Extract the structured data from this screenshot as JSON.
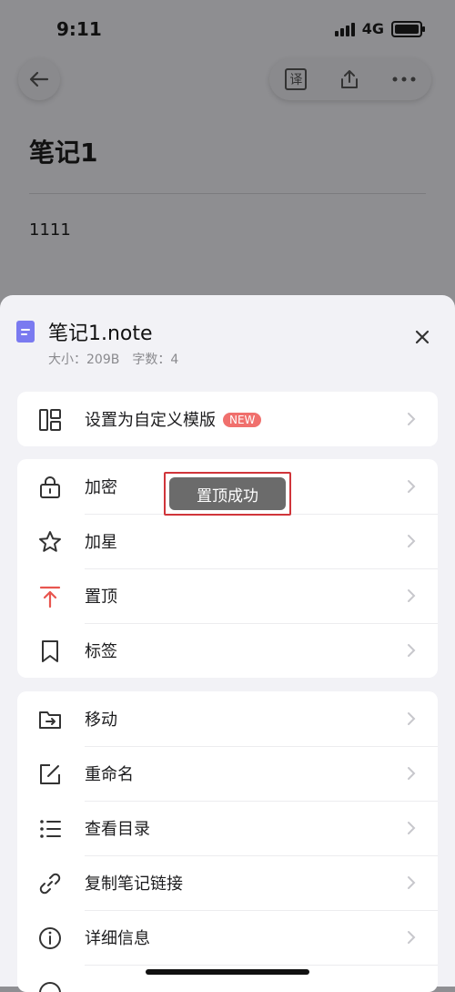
{
  "status_bar": {
    "time": "9:11",
    "network": "4G"
  },
  "note": {
    "title": "笔记1",
    "body": "1111"
  },
  "toolbar": {
    "icons": [
      "back-arrow-icon",
      "translate-icon",
      "share-icon",
      "more-icon"
    ],
    "translate_glyph": "译"
  },
  "sheet": {
    "file_name": "笔记1.note",
    "file_meta": "大小：209B　字数：4",
    "groups": [
      {
        "items": [
          {
            "label": "设置为自定义模版",
            "icon": "template-icon",
            "badge": "NEW"
          }
        ]
      },
      {
        "items": [
          {
            "label": "加密",
            "icon": "lock-icon"
          },
          {
            "label": "加星",
            "icon": "star-icon"
          },
          {
            "label": "置顶",
            "icon": "pin-top-icon"
          },
          {
            "label": "标签",
            "icon": "bookmark-icon"
          }
        ]
      },
      {
        "items": [
          {
            "label": "移动",
            "icon": "move-folder-icon"
          },
          {
            "label": "重命名",
            "icon": "rename-icon"
          },
          {
            "label": "查看目录",
            "icon": "list-icon"
          },
          {
            "label": "复制笔记链接",
            "icon": "link-icon"
          },
          {
            "label": "详细信息",
            "icon": "info-icon"
          }
        ]
      }
    ]
  },
  "toast": {
    "text": "置顶成功"
  },
  "colors": {
    "accent_red": "#f0706d",
    "pin_red": "#e8564f",
    "file_icon": "#7a7af0"
  }
}
